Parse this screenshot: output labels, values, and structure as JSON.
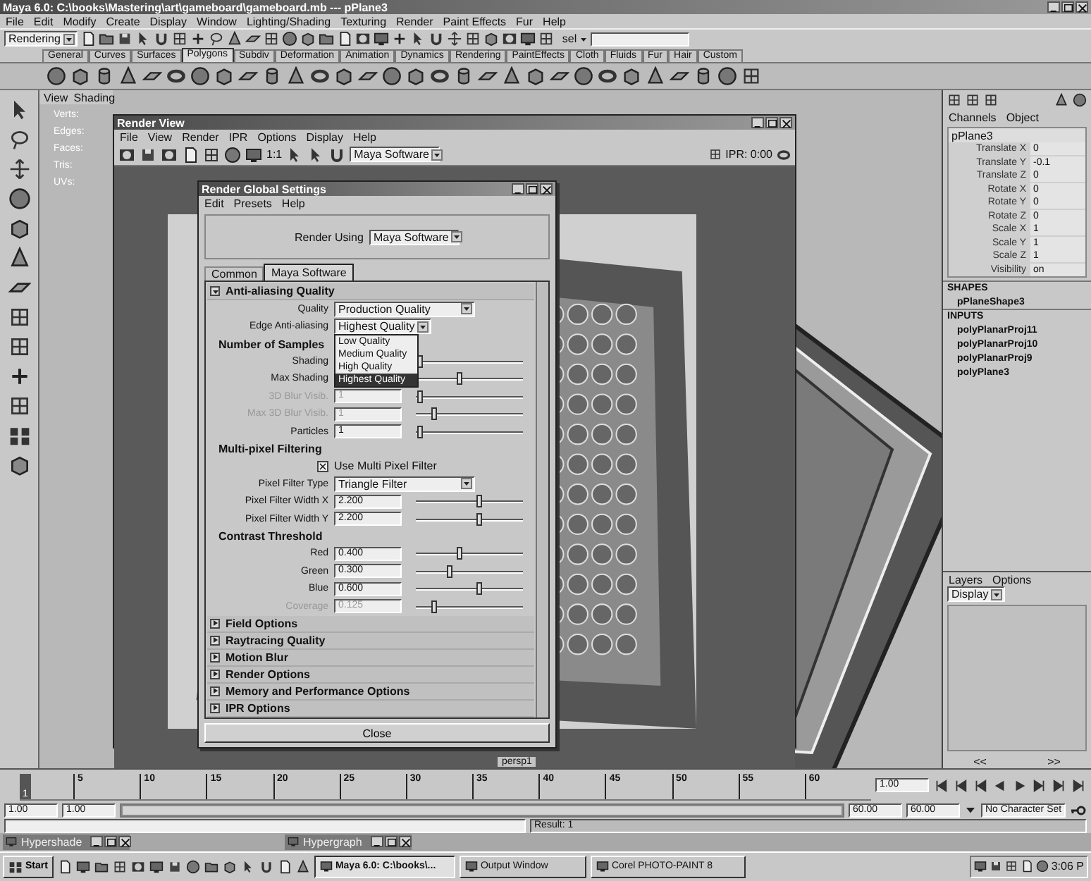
{
  "window": {
    "title": "Maya 6.0: C:\\books\\Mastering\\art\\gameboard\\gameboard.mb  ---  pPlane3"
  },
  "menu_bar": [
    "File",
    "Edit",
    "Modify",
    "Create",
    "Display",
    "Window",
    "Lighting/Shading",
    "Texturing",
    "Render",
    "Paint Effects",
    "Fur",
    "Help"
  ],
  "status_line": {
    "menu_set": "Rendering",
    "selection_label": "sel"
  },
  "shelf_tabs": [
    {
      "label": "General",
      "selected": false
    },
    {
      "label": "Curves",
      "selected": false
    },
    {
      "label": "Surfaces",
      "selected": false
    },
    {
      "label": "Polygons",
      "selected": true
    },
    {
      "label": "Subdiv",
      "selected": false
    },
    {
      "label": "Deformation",
      "selected": false
    },
    {
      "label": "Animation",
      "selected": false
    },
    {
      "label": "Dynamics",
      "selected": false
    },
    {
      "label": "Rendering",
      "selected": false
    },
    {
      "label": "PaintEffects",
      "selected": false
    },
    {
      "label": "Cloth",
      "selected": false
    },
    {
      "label": "Fluids",
      "selected": false
    },
    {
      "label": "Fur",
      "selected": false
    },
    {
      "label": "Hair",
      "selected": false
    },
    {
      "label": "Custom",
      "selected": false
    }
  ],
  "viewport": {
    "panel_menu": [
      "View",
      "Shading"
    ],
    "hud_labels": [
      "Verts:",
      "Edges:",
      "Faces:",
      "Tris:",
      "UVs:"
    ],
    "camera": "persp1"
  },
  "render_view": {
    "title": "Render View",
    "menu": [
      "File",
      "View",
      "Render",
      "IPR",
      "Options",
      "Display",
      "Help"
    ],
    "ratio_button": "1:1",
    "renderer": "Maya Software",
    "ipr_status": "IPR: 0:00"
  },
  "render_globals": {
    "title": "Render Global Settings",
    "menu": [
      "Edit",
      "Presets",
      "Help"
    ],
    "render_using_label": "Render Using",
    "render_using": "Maya Software",
    "tabs": [
      {
        "label": "Common",
        "selected": false
      },
      {
        "label": "Maya Software",
        "selected": true
      }
    ],
    "sections": [
      {
        "title": "Anti-aliasing Quality",
        "expanded": true,
        "rows": [
          {
            "kind": "dropdown",
            "label": "Quality",
            "value": "Production Quality",
            "expanded": false
          },
          {
            "kind": "dropdown",
            "label": "Edge Anti-aliasing",
            "value": "Highest Quality",
            "expanded": true,
            "options": [
              {
                "label": "Low Quality",
                "selected": false
              },
              {
                "label": "Medium Quality",
                "selected": false
              },
              {
                "label": "High Quality",
                "selected": false
              },
              {
                "label": "Highest Quality",
                "selected": true
              }
            ]
          },
          {
            "kind": "heading",
            "label": "Number of Samples"
          },
          {
            "kind": "slider",
            "label": "Shading",
            "disabled": false,
            "level": 0.02
          },
          {
            "kind": "slider",
            "label": "Max Shading",
            "disabled": false,
            "level": 0.4
          },
          {
            "kind": "slider",
            "label": "3D Blur Visib.",
            "value": "1",
            "disabled": true,
            "level": 0.02
          },
          {
            "kind": "slider",
            "label": "Max 3D Blur Visib.",
            "value": "1",
            "disabled": true,
            "level": 0.15
          },
          {
            "kind": "slider",
            "label": "Particles",
            "value": "1",
            "disabled": false,
            "level": 0.02
          },
          {
            "kind": "heading",
            "label": "Multi-pixel Filtering"
          },
          {
            "kind": "checkbox",
            "label": "Use Multi Pixel Filter",
            "checked": true
          },
          {
            "kind": "dropdown",
            "label": "Pixel Filter Type",
            "value": "Triangle Filter",
            "expanded": false
          },
          {
            "kind": "slider",
            "label": "Pixel Filter Width X",
            "value": "2.200",
            "disabled": false,
            "level": 0.6
          },
          {
            "kind": "slider",
            "label": "Pixel Filter Width Y",
            "value": "2.200",
            "disabled": false,
            "level": 0.6
          },
          {
            "kind": "heading",
            "label": "Contrast Threshold"
          },
          {
            "kind": "slider",
            "label": "Red",
            "value": "0.400",
            "disabled": false,
            "level": 0.4
          },
          {
            "kind": "slider",
            "label": "Green",
            "value": "0.300",
            "disabled": false,
            "level": 0.3
          },
          {
            "kind": "slider",
            "label": "Blue",
            "value": "0.600",
            "disabled": false,
            "level": 0.6
          },
          {
            "kind": "slider",
            "label": "Coverage",
            "value": "0.125",
            "disabled": true,
            "level": 0.15
          }
        ]
      },
      {
        "title": "Field Options",
        "expanded": false
      },
      {
        "title": "Raytracing Quality",
        "expanded": false
      },
      {
        "title": "Motion Blur",
        "expanded": false
      },
      {
        "title": "Render Options",
        "expanded": false
      },
      {
        "title": "Memory and Performance Options",
        "expanded": false
      },
      {
        "title": "IPR Options",
        "expanded": false
      }
    ],
    "close_button": "Close"
  },
  "channel_box": {
    "menu": [
      "Channels",
      "Object"
    ],
    "node": "pPlane3",
    "attributes": [
      {
        "name": "Translate X",
        "value": "0"
      },
      {
        "name": "Translate Y",
        "value": "-0.1"
      },
      {
        "name": "Translate Z",
        "value": "0"
      },
      {
        "name": "Rotate X",
        "value": "0"
      },
      {
        "name": "Rotate Y",
        "value": "0"
      },
      {
        "name": "Rotate Z",
        "value": "0"
      },
      {
        "name": "Scale X",
        "value": "1"
      },
      {
        "name": "Scale Y",
        "value": "1"
      },
      {
        "name": "Scale Z",
        "value": "1"
      },
      {
        "name": "Visibility",
        "value": "on"
      }
    ],
    "shapes_heading": "SHAPES",
    "shapes": [
      "pPlaneShape3"
    ],
    "inputs_heading": "INPUTS",
    "inputs": [
      "polyPlanarProj11",
      "polyPlanarProj10",
      "polyPlanarProj9",
      "polyPlane3"
    ]
  },
  "layers": {
    "menu": [
      "Layers",
      "Options"
    ],
    "display": "Display",
    "nav": [
      "<<",
      ">>"
    ]
  },
  "time_slider": {
    "level": 0,
    "current_frame_marker": "1",
    "ticks": [
      "5",
      "10",
      "15",
      "20",
      "25",
      "30",
      "35",
      "40",
      "45",
      "50",
      "55",
      "60"
    ],
    "current_frame": "1.00"
  },
  "range_slider": {
    "level": 1,
    "start": "1.00",
    "playback_start": "1.00",
    "playback_end": "60.00",
    "end": "60.00",
    "character_set": "No Character Set"
  },
  "command_line": {
    "result": "Result: 1"
  },
  "minimized_windows": [
    "Hypershade",
    "Hypergraph"
  ],
  "taskbar": {
    "start": "Start",
    "tasks": [
      {
        "label": "Maya 6.0: C:\\books\\...",
        "selected": true
      },
      {
        "label": "Output Window",
        "selected": false
      },
      {
        "label": "Corel PHOTO-PAINT 8",
        "selected": false
      }
    ],
    "clock": "3:06 P"
  }
}
